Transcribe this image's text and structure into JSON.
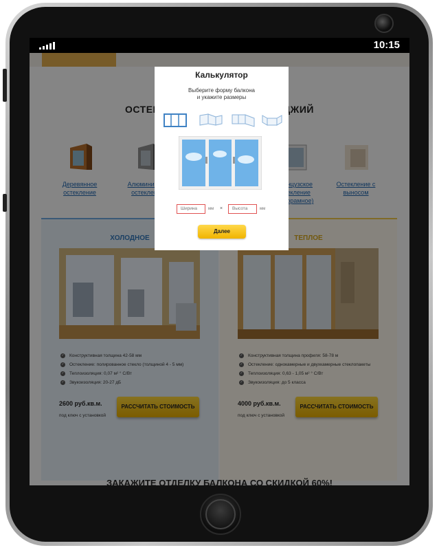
{
  "status_bar": {
    "time": "10:15"
  },
  "page": {
    "section_title": "ОСТЕКЛЕНИЕ БАЛКОНОВ И ЛОДЖИЙ",
    "glazing_types": [
      {
        "label": "Деревянное остекление",
        "icon": "wood-window-icon"
      },
      {
        "label": "Алюминиевое остекление",
        "icon": "aluminum-window-icon"
      },
      {
        "label": "",
        "icon": "pvc-window-icon"
      },
      {
        "label": "Французское остекление (панорамное)",
        "icon": "french-window-icon"
      },
      {
        "label": "Остекление с выносом",
        "icon": "extended-window-icon"
      }
    ],
    "columns": [
      {
        "title": "ХОЛОДНОЕ",
        "bullets": [
          "Конструктивная толщина 42-58 мм",
          "Остекление: полированное стекло (толщиной 4 - 5 мм)",
          "Теплоизоляция: 0,07 м² ° С/Вт",
          "Звукоизоляция: 20-27 дБ"
        ],
        "price": "2600 руб.кв.м.",
        "price_note": "под ключ с установкой",
        "button": "РАССЧИТАТЬ СТОИМОСТЬ"
      },
      {
        "title": "ТЕПЛОЕ",
        "bullets": [
          "Конструктивная толщина профиля: 58-78 м",
          "Остекление: однокамерные и двухкамерные стеклопакеты",
          "Теплоизоляция: 0,63 - 1,05 м² ° С/Вт",
          "Звукоизоляция: до 5 класса"
        ],
        "price": "4000 руб.кв.м.",
        "price_note": "под ключ с установкой",
        "button": "РАССЧИТАТЬ СТОИМОСТЬ"
      }
    ],
    "bottom_title": "ЗАКАЖИТЕ ОТДЕЛКУ БАЛКОНА СО СКИДКОЙ 60%!"
  },
  "modal": {
    "title": "Калькулятор",
    "subtitle_line1": "Выберите форму балкона",
    "subtitle_line2": "и укажите размеры",
    "shapes": [
      "straight-balcony-icon",
      "angled-balcony-icon",
      "corner-balcony-icon",
      "u-shape-balcony-icon"
    ],
    "width_placeholder": "Ширина",
    "height_placeholder": "Высота",
    "unit": "мм",
    "times": "×",
    "next_button": "Далее"
  }
}
